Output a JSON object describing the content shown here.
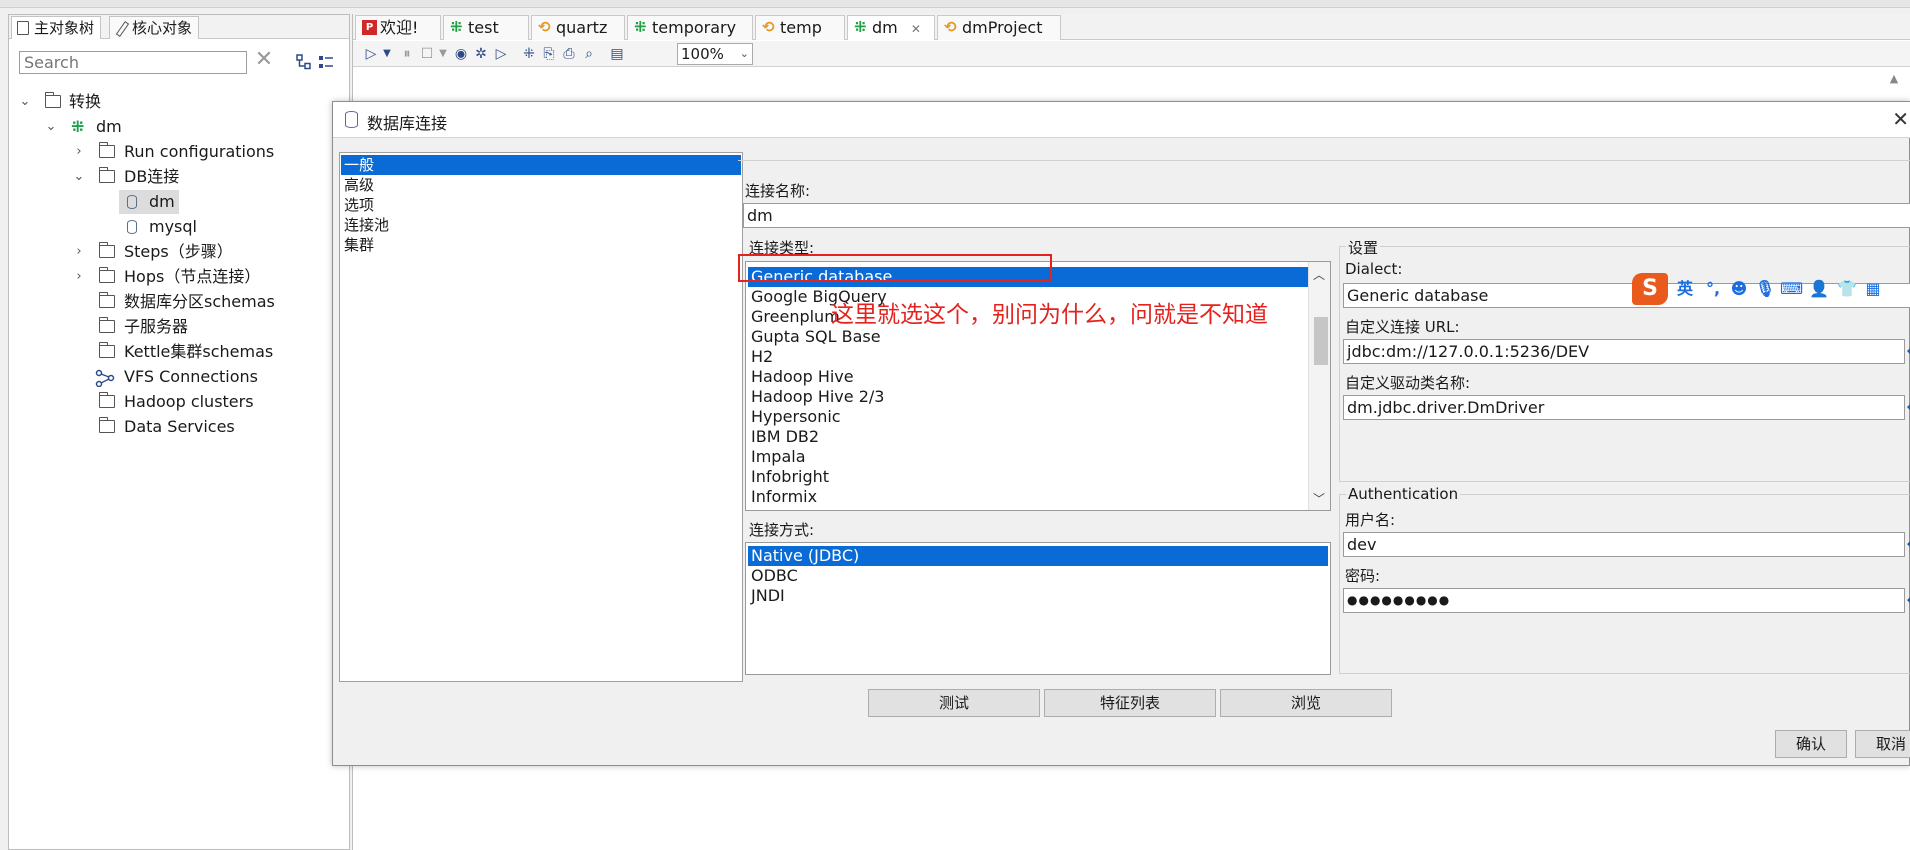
{
  "left_panel": {
    "tabs": [
      {
        "label": "主对象树"
      },
      {
        "label": "核心对象"
      }
    ],
    "search_placeholder": "Search",
    "tree": {
      "root": "转换",
      "transformation": "dm",
      "items": [
        {
          "label": "Run configurations"
        },
        {
          "label": "DB连接"
        },
        {
          "label": "dm"
        },
        {
          "label": "mysql"
        },
        {
          "label": "Steps（步骤）"
        },
        {
          "label": "Hops（节点连接）"
        },
        {
          "label": "数据库分区schemas"
        },
        {
          "label": "子服务器"
        },
        {
          "label": "Kettle集群schemas"
        },
        {
          "label": "VFS Connections"
        },
        {
          "label": "Hadoop clusters"
        },
        {
          "label": "Data Services"
        }
      ]
    }
  },
  "editor": {
    "tabs": [
      {
        "label": "欢迎!",
        "icon": "welcome-icon"
      },
      {
        "label": "test",
        "icon": "transformation-icon"
      },
      {
        "label": "quartz",
        "icon": "job-icon"
      },
      {
        "label": "temporary",
        "icon": "transformation-icon"
      },
      {
        "label": "temp",
        "icon": "job-icon"
      },
      {
        "label": "dm",
        "icon": "transformation-icon",
        "active": true
      },
      {
        "label": "dmProject",
        "icon": "job-icon"
      }
    ],
    "zoom": "100%"
  },
  "dialog": {
    "title": "数据库连接",
    "categories": [
      "一般",
      "高级",
      "选项",
      "连接池",
      "集群"
    ],
    "selected_category": "一般",
    "connection_name_label": "连接名称:",
    "connection_name": "dm",
    "connection_type_label": "连接类型:",
    "connection_types": [
      "Generic database",
      "Google BigQuery",
      "Greenplum",
      "Gupta SQL Base",
      "H2",
      "Hadoop Hive",
      "Hadoop Hive 2/3",
      "Hypersonic",
      "IBM DB2",
      "Impala",
      "Infobright",
      "Informix"
    ],
    "selected_type": "Generic database",
    "access_label": "连接方式:",
    "access_types": [
      "Native (JDBC)",
      "ODBC",
      "JNDI"
    ],
    "selected_access": "Native (JDBC)",
    "settings": {
      "title": "设置",
      "dialect_label": "Dialect:",
      "dialect": "Generic database",
      "url_label": "自定义连接 URL:",
      "url": "jdbc:dm://127.0.0.1:5236/DEV",
      "driver_label": "自定义驱动类名称:",
      "driver": "dm.jdbc.driver.DmDriver"
    },
    "auth": {
      "title": "Authentication",
      "username_label": "用户名:",
      "username": "dev",
      "password_label": "密码:",
      "password": "●●●●●●●●●"
    },
    "buttons": {
      "test": "测试",
      "features": "特征列表",
      "explore": "浏览",
      "ok": "确认",
      "cancel": "取消"
    }
  },
  "annotation": {
    "text": "这里就选这个，别问为什么，问就是不知道",
    "color": "#e4231f"
  },
  "ime": {
    "logo": "S",
    "lang": "英"
  },
  "colors": {
    "selection": "#0a6ad6",
    "transformation_icon": "#22a045",
    "job_icon": "#e69a1d"
  }
}
